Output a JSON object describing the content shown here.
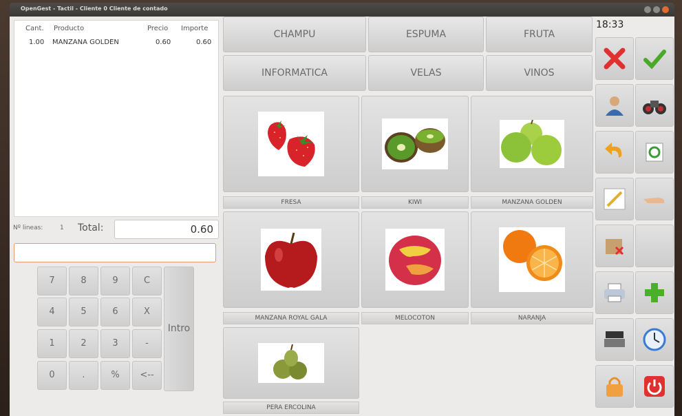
{
  "window": {
    "title": "OpenGest - Tactil - Cliente 0 Cliente de contado"
  },
  "ticket": {
    "headers": {
      "qty": "Cant.",
      "product": "Producto",
      "price": "Precio",
      "amount": "Importe"
    },
    "rows": [
      {
        "qty": "1.00",
        "product": "MANZANA GOLDEN",
        "price": "0.60",
        "amount": "0.60"
      }
    ],
    "lines_label": "Nº lineas:",
    "lines_count": "1",
    "total_label": "Total:",
    "total_value": "0.60",
    "entry_value": ""
  },
  "keypad": {
    "keys": [
      "7",
      "8",
      "9",
      "C",
      "4",
      "5",
      "6",
      "X",
      "1",
      "2",
      "3",
      "-",
      "0",
      ".",
      "%",
      "<--"
    ],
    "intro": "Intro"
  },
  "categories": [
    "CHAMPU",
    "ESPUMA",
    "FRUTA",
    "INFORMATICA",
    "VELAS",
    "VINOS"
  ],
  "products": [
    {
      "name": "FRESA",
      "icon": "strawberry-image"
    },
    {
      "name": "KIWI",
      "icon": "kiwi-image"
    },
    {
      "name": "MANZANA GOLDEN",
      "icon": "green-apple-image"
    },
    {
      "name": "MANZANA ROYAL GALA",
      "icon": "red-apple-image"
    },
    {
      "name": "MELOCOTON",
      "icon": "peach-image"
    },
    {
      "name": "NARANJA",
      "icon": "orange-image"
    },
    {
      "name": "PERA ERCOLINA",
      "icon": "pear-image"
    }
  ],
  "clock": "18:33",
  "sidebar_icons": [
    "cancel-icon",
    "accept-icon",
    "customer-icon",
    "search-binoculars-icon",
    "undo-icon",
    "recycle-icon",
    "edit-pencil-icon",
    "hand-pointer-icon",
    "delete-box-icon",
    "blank-icon",
    "print-icon",
    "add-icon",
    "cash-drawer-icon",
    "clock-icon",
    "lock-icon",
    "power-icon"
  ],
  "colors": {
    "accent_entry": "#e89a6a",
    "cancel": "#e03030",
    "accept": "#4aa82a"
  }
}
